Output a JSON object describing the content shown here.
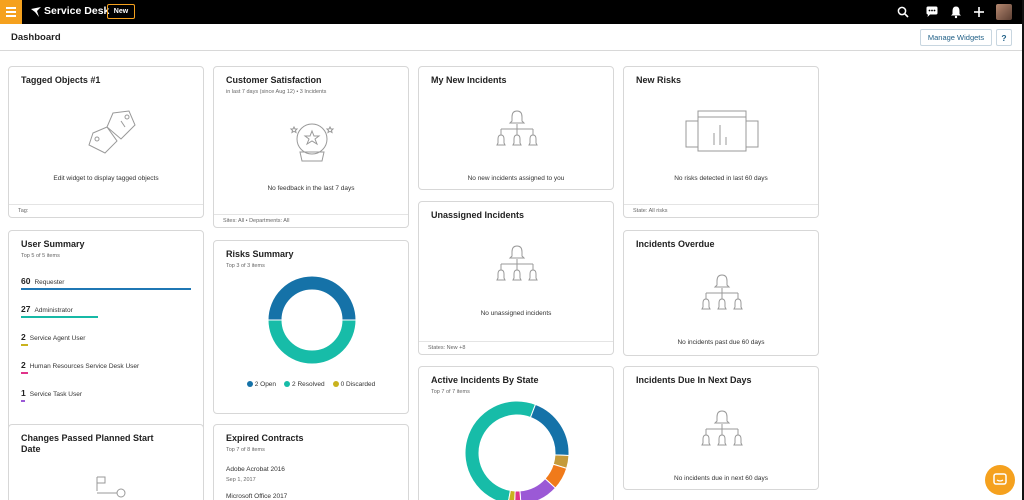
{
  "app": {
    "name": "Service Desk",
    "new_label": "New",
    "page_title": "Dashboard",
    "accent": "#f5a11e"
  },
  "toolbar": {
    "manage_widgets": "Manage Widgets",
    "help": "?"
  },
  "widgets": {
    "tagged_objects": {
      "title": "Tagged Objects #1",
      "message": "Edit widget to display tagged objects",
      "footer": "Tag:"
    },
    "customer_satisfaction": {
      "title": "Customer Satisfaction",
      "subtitle": "in last 7 days (since Aug 12)  •  3 Incidents",
      "message": "No feedback in the last 7 days",
      "footer": "Sites: All  •  Departments: All"
    },
    "my_new_incidents": {
      "title": "My New Incidents",
      "message": "No new incidents assigned to you"
    },
    "new_risks": {
      "title": "New Risks",
      "message": "No risks detected in last 60 days",
      "footer": "State: All risks"
    },
    "user_summary": {
      "title": "User Summary",
      "subtitle": "Top 5 of 5 items",
      "rows": [
        {
          "count": "60",
          "label": "Requester",
          "color": "#1f77b4",
          "fraction": 1.0
        },
        {
          "count": "27",
          "label": "Administrator",
          "color": "#17b9a6",
          "fraction": 0.45
        },
        {
          "count": "2",
          "label": "Service Agent User",
          "color": "#c9b21e",
          "fraction": 0.04
        },
        {
          "count": "2",
          "label": "Human Resources Service Desk User",
          "color": "#e0338a",
          "fraction": 0.04
        },
        {
          "count": "1",
          "label": "Service Task User",
          "color": "#9b59d6",
          "fraction": 0.02
        }
      ]
    },
    "risks_summary": {
      "title": "Risks Summary",
      "subtitle": "Top 3 of 3 items",
      "legend": [
        {
          "label": "2 Open",
          "color": "#1572a8"
        },
        {
          "label": "2 Resolved",
          "color": "#17bca8"
        },
        {
          "label": "0 Discarded",
          "color": "#c9b21e"
        }
      ]
    },
    "unassigned_incidents": {
      "title": "Unassigned Incidents",
      "message": "No unassigned incidents",
      "footer": "States: New +8"
    },
    "incidents_overdue": {
      "title": "Incidents Overdue",
      "message": "No incidents past due 60 days"
    },
    "changes_passed": {
      "title": "Changes Passed Planned Start Date"
    },
    "expired_contracts": {
      "title": "Expired Contracts",
      "subtitle": "Top 7 of 8 items",
      "items": [
        {
          "name": "Adobe Acrobat 2016",
          "date": "Sep 1, 2017"
        },
        {
          "name": "Microsoft Office 2017",
          "date": ""
        }
      ]
    },
    "active_incidents": {
      "title": "Active Incidents By State",
      "subtitle": "Top 7 of 7 items"
    },
    "incidents_due": {
      "title": "Incidents Due In Next Days",
      "message": "No incidents due in next 60 days"
    }
  },
  "chart_data": [
    {
      "type": "pie",
      "title": "Risks Summary",
      "categories": [
        "Open",
        "Resolved",
        "Discarded"
      ],
      "values": [
        2,
        2,
        0
      ],
      "colors": [
        "#1572a8",
        "#17bca8",
        "#c9b21e"
      ]
    },
    {
      "type": "pie",
      "title": "Active Incidents By State",
      "categories": [
        "",
        "",
        "",
        "",
        "",
        "",
        ""
      ],
      "values": [
        53,
        20,
        4,
        7,
        12,
        2,
        2
      ],
      "colors": [
        "#17bca8",
        "#1572a8",
        "#c49a3a",
        "#f07a1a",
        "#9b59d6",
        "#e0338a",
        "#c9b21e"
      ]
    }
  ]
}
